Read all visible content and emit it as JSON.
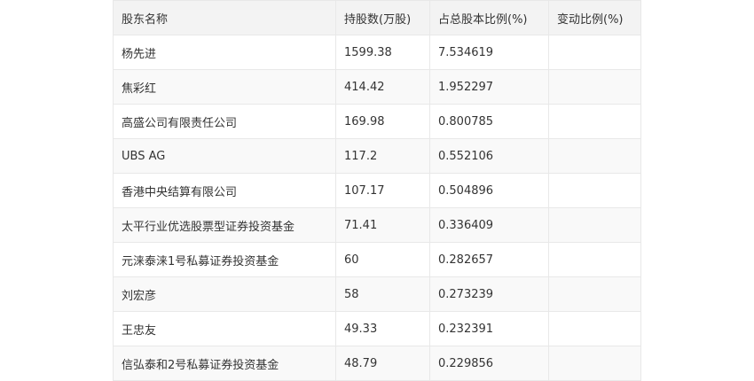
{
  "table": {
    "headers": {
      "name": "股东名称",
      "shares": "持股数(万股)",
      "ratio": "占总股本比例(%)",
      "change": "变动比例(%)"
    },
    "rows": [
      {
        "name": "杨先进",
        "shares": "1599.38",
        "ratio": "7.534619",
        "change": ""
      },
      {
        "name": "焦彩红",
        "shares": "414.42",
        "ratio": "1.952297",
        "change": ""
      },
      {
        "name": "高盛公司有限责任公司",
        "shares": "169.98",
        "ratio": "0.800785",
        "change": ""
      },
      {
        "name": "UBS AG",
        "shares": "117.2",
        "ratio": "0.552106",
        "change": ""
      },
      {
        "name": "香港中央结算有限公司",
        "shares": "107.17",
        "ratio": "0.504896",
        "change": ""
      },
      {
        "name": "太平行业优选股票型证券投资基金",
        "shares": "71.41",
        "ratio": "0.336409",
        "change": ""
      },
      {
        "name": "元涞泰涞1号私募证券投资基金",
        "shares": "60",
        "ratio": "0.282657",
        "change": ""
      },
      {
        "name": "刘宏彦",
        "shares": "58",
        "ratio": "0.273239",
        "change": ""
      },
      {
        "name": "王忠友",
        "shares": "49.33",
        "ratio": "0.232391",
        "change": ""
      },
      {
        "name": "信弘泰和2号私募证券投资基金",
        "shares": "48.79",
        "ratio": "0.229856",
        "change": ""
      }
    ]
  }
}
